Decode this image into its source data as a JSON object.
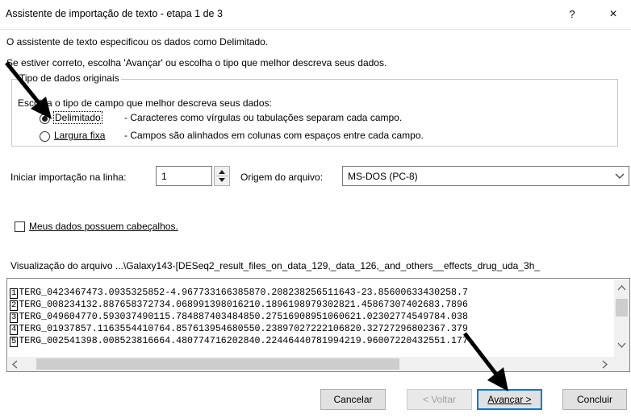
{
  "window": {
    "title": "Assistente de importação de texto - etapa 1 de 3",
    "help_label": "?",
    "close_label": "×"
  },
  "intro": {
    "line1": "O assistente de texto especificou os dados como Delimitado.",
    "line2": "Se estiver correto, escolha 'Avançar' ou escolha o tipo que melhor descreva seus dados."
  },
  "original_type": {
    "group_title": "Tipo de dados originais",
    "prompt": "Escolha o tipo de campo que melhor descreva seus dados:",
    "options": [
      {
        "label": "Delimitado",
        "description": "- Caracteres como vírgulas ou tabulações separam cada campo.",
        "selected": true
      },
      {
        "label": "Largura fixa",
        "description": "- Campos são alinhados em colunas com espaços entre cada campo.",
        "selected": false
      }
    ]
  },
  "start_row": {
    "label": "Iniciar importação na linha:",
    "value": "1"
  },
  "file_origin": {
    "label": "Origem do arquivo:",
    "value": "MS-DOS (PC-8)"
  },
  "headers_checkbox": {
    "label": "Meus dados possuem cabeçalhos.",
    "checked": false
  },
  "preview": {
    "label": "Visualização do arquivo ...\\Galaxy143-[DESeq2_result_files_on_data_129,_data_126,_and_others__effects_drug_uda_3h_",
    "rows": [
      {
        "num": "1",
        "text": "TERG_0423467473.0935325852-4.967733166385870.208238256511643-23.85600633430258.7"
      },
      {
        "num": "2",
        "text": "TERG_008234132.887658372734.068991398016210.1896198979302821.45867307402683.7896"
      },
      {
        "num": "3",
        "text": "TERG_049604770.593037490115.784887403484850.27516908951060621.02302774549784.038"
      },
      {
        "num": "4",
        "text": "TERG_01937857.1163554410764.857613954680550.23897027222106820.32727296802367.379"
      },
      {
        "num": "5",
        "text": "TERG_002541398.008523816664.480774716202840.22446440781994219.96007220432551.177"
      }
    ]
  },
  "buttons": {
    "cancel": "Cancelar",
    "back": "< Voltar",
    "next": "Avançar >",
    "finish": "Concluir"
  },
  "colors": {
    "accent": "#0078d7",
    "button_face": "#e1e1e1",
    "disabled_text": "#a0a0a0"
  }
}
